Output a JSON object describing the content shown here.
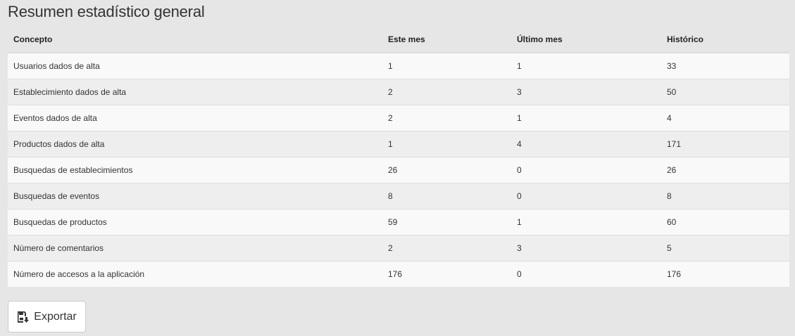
{
  "page": {
    "title": "Resumen estadístico general"
  },
  "table": {
    "headers": [
      "Concepto",
      "Este mes",
      "Último mes",
      "Histórico"
    ],
    "rows": [
      [
        "Usuarios dados de alta",
        "1",
        "1",
        "33"
      ],
      [
        "Establecimiento dados de alta",
        "2",
        "3",
        "50"
      ],
      [
        "Eventos dados de alta",
        "2",
        "1",
        "4"
      ],
      [
        "Productos dados de alta",
        "1",
        "4",
        "171"
      ],
      [
        "Busquedas de establecimientos",
        "26",
        "0",
        "26"
      ],
      [
        "Busquedas de eventos",
        "8",
        "0",
        "8"
      ],
      [
        "Busquedas de productos",
        "59",
        "1",
        "60"
      ],
      [
        "Número de comentarios",
        "2",
        "3",
        "5"
      ],
      [
        "Número de accesos a la aplicación",
        "176",
        "0",
        "176"
      ]
    ]
  },
  "actions": {
    "export_label": "Exportar",
    "export_icon": "save-download-icon"
  }
}
